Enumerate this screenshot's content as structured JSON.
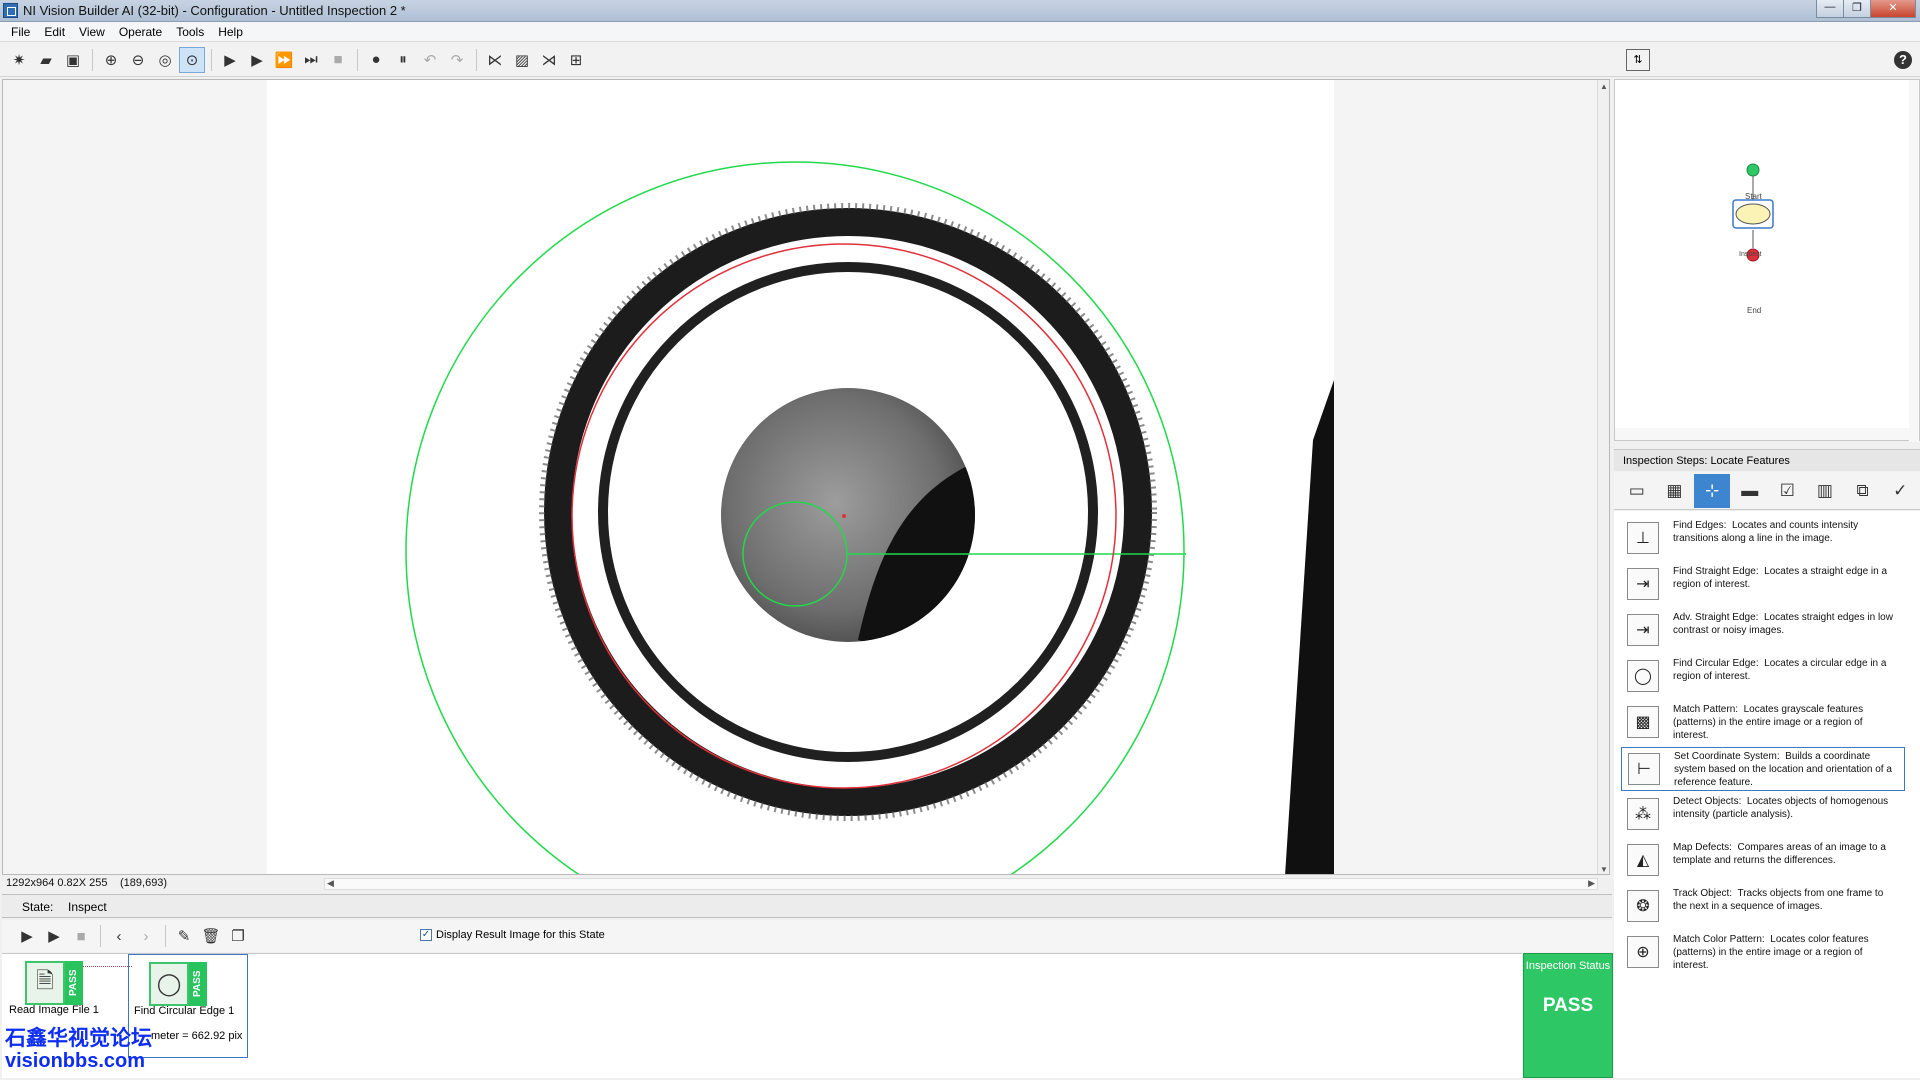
{
  "window": {
    "title": "NI Vision Builder AI (32-bit) - Configuration - Untitled Inspection 2 *"
  },
  "menu": [
    "File",
    "Edit",
    "View",
    "Operate",
    "Tools",
    "Help"
  ],
  "image_info": {
    "size_zoom": "1292x964 0.82X 255",
    "coord": "(189,693)"
  },
  "state": {
    "label": "State:",
    "value": "Inspect"
  },
  "display_result": {
    "label": "Display Result Image for this State",
    "checked": true
  },
  "steps": [
    {
      "name": "Read Image File 1",
      "status": "PASS",
      "result": ""
    },
    {
      "name": "Find Circular Edge 1",
      "status": "PASS",
      "result": "meter = 662.92 pix"
    }
  ],
  "inspection_status": {
    "title": "Inspection Status",
    "value": "PASS",
    "color": "#2ec765"
  },
  "flowchart": {
    "start": "Start",
    "inspect": "Inspect",
    "end": "End"
  },
  "steps_panel": {
    "header": "Inspection Steps: Locate Features",
    "items": [
      {
        "name": "Find Edges:",
        "desc": "Locates and counts intensity transitions along a line in the image."
      },
      {
        "name": "Find Straight Edge:",
        "desc": "Locates a straight edge in a region of interest."
      },
      {
        "name": "Adv. Straight Edge:",
        "desc": "Locates straight edges in low contrast or noisy images."
      },
      {
        "name": "Find Circular Edge:",
        "desc": "Locates a circular edge in a region of interest."
      },
      {
        "name": "Match Pattern:",
        "desc": "Locates grayscale features (patterns) in the entire image or a region of interest."
      },
      {
        "name": "Set Coordinate System:",
        "desc": "Builds a coordinate system based on the location and orientation of a reference feature."
      },
      {
        "name": "Detect Objects:",
        "desc": "Locates objects of homogenous intensity (particle analysis)."
      },
      {
        "name": "Map Defects:",
        "desc": "Compares areas of an image to a template and returns the differences."
      },
      {
        "name": "Track Object:",
        "desc": "Tracks objects from one frame to the next in a sequence of images."
      },
      {
        "name": "Match Color Pattern:",
        "desc": "Locates color features (patterns) in the entire image or a region of interest."
      }
    ]
  },
  "watermark": {
    "cn": "石鑫华视觉论坛",
    "url": "visionbbs.com"
  },
  "colors": {
    "overlay_green": "#21d94a",
    "overlay_red": "#e0303a",
    "pass_green": "#2ec765",
    "accent_blue": "#3d86cf"
  }
}
